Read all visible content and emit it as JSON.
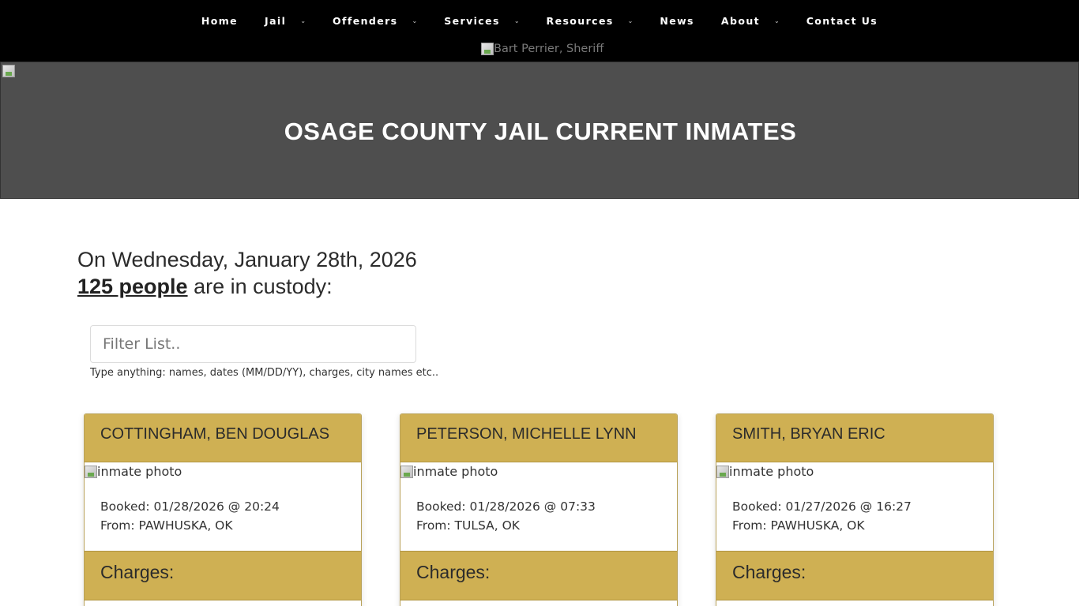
{
  "nav": {
    "items": [
      {
        "label": "Home",
        "dropdown": false
      },
      {
        "label": "Jail",
        "dropdown": true
      },
      {
        "label": "Offenders",
        "dropdown": true
      },
      {
        "label": "Services",
        "dropdown": true
      },
      {
        "label": "Resources",
        "dropdown": true
      },
      {
        "label": "News",
        "dropdown": false
      },
      {
        "label": "About",
        "dropdown": true
      },
      {
        "label": "Contact Us",
        "dropdown": false
      }
    ],
    "logo_alt": "Bart Perrier, Sheriff"
  },
  "hero": {
    "title": "OSAGE COUNTY JAIL CURRENT INMATES"
  },
  "summary": {
    "date_line": "On Wednesday, January 28th, 2026",
    "count": "125 people",
    "custody_text": " are in custody:"
  },
  "filter": {
    "placeholder": "Filter List..",
    "value": "",
    "hint": "Type anything: names, dates (MM/DD/YY), charges, city names etc.."
  },
  "inmates": [
    {
      "name": "COTTINGHAM, BEN DOUGLAS",
      "photo_alt": "inmate photo",
      "booked": "Booked: 01/28/2026 @ 20:24",
      "from": "From: PAWHUSKA, OK",
      "charges_label": "Charges:"
    },
    {
      "name": "PETERSON, MICHELLE LYNN",
      "photo_alt": "inmate photo",
      "booked": "Booked: 01/28/2026 @ 07:33",
      "from": "From: TULSA, OK",
      "charges_label": "Charges:"
    },
    {
      "name": "SMITH, BRYAN ERIC",
      "photo_alt": "inmate photo",
      "booked": "Booked: 01/27/2026 @ 16:27",
      "from": "From: PAWHUSKA, OK",
      "charges_label": "Charges:"
    }
  ],
  "colors": {
    "nav_bg": "#000000",
    "hero_bg": "#4e4e4e",
    "card_accent": "#cfb053"
  },
  "icons": {
    "dropdown": "chevron-down-icon",
    "broken_image": "broken-image-icon"
  }
}
